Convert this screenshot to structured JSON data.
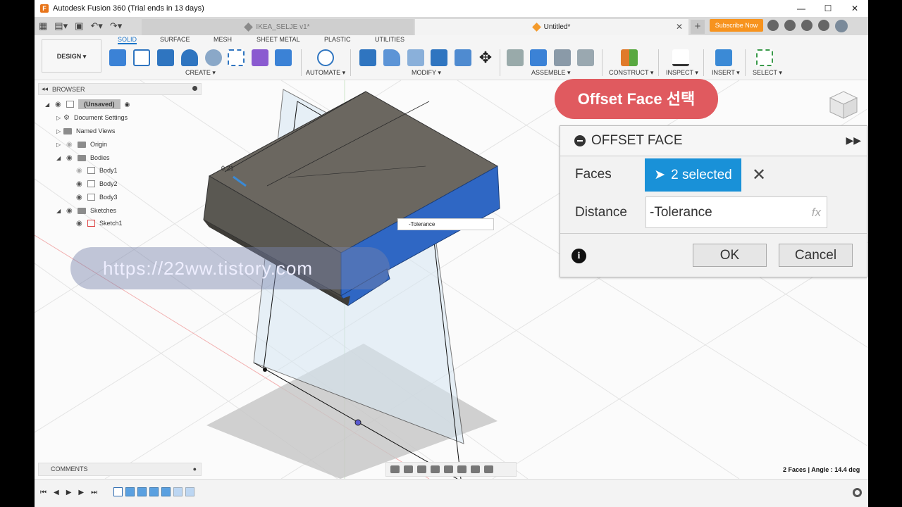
{
  "window": {
    "title": "Autodesk Fusion 360 (Trial ends in 13 days)",
    "controls": {
      "minimize": "—",
      "maximize": "☐",
      "close": "✕"
    }
  },
  "tabs": {
    "inactive_label": "IKEA_SELJE v1*",
    "active_label": "Untitled*",
    "close_glyph": "✕",
    "new_tab_glyph": "+",
    "subscribe_label": "Subscribe Now"
  },
  "ribbon": {
    "workspace_label": "DESIGN ▾",
    "tabs": [
      "SOLID",
      "SURFACE",
      "MESH",
      "SHEET METAL",
      "PLASTIC",
      "UTILITIES"
    ],
    "groups": [
      "CREATE ▾",
      "AUTOMATE ▾",
      "MODIFY ▾",
      "ASSEMBLE ▾",
      "CONSTRUCT ▾",
      "INSPECT ▾",
      "INSERT ▾",
      "SELECT ▾"
    ]
  },
  "browser": {
    "title": "BROWSER",
    "items": [
      {
        "label": "(Unsaved)"
      },
      {
        "label": "Document Settings"
      },
      {
        "label": "Named Views"
      },
      {
        "label": "Origin"
      },
      {
        "label": "Bodies"
      },
      {
        "label": "Body1"
      },
      {
        "label": "Body2"
      },
      {
        "label": "Body3"
      },
      {
        "label": "Sketches"
      },
      {
        "label": "Sketch1"
      }
    ]
  },
  "viewport": {
    "watermark": "https://22ww.tistory.com",
    "dimension_label": "0.21",
    "tolerance_tag": "-Tolerance"
  },
  "caption": {
    "text": "Offset Face 선택",
    "color": "#e05a5f"
  },
  "dialog": {
    "title": "OFFSET FACE",
    "faces_label": "Faces",
    "faces_value": "2 selected",
    "distance_label": "Distance",
    "distance_value": "-Tolerance",
    "fx_label": "fx",
    "ok_label": "OK",
    "cancel_label": "Cancel",
    "accent": "#1991d8"
  },
  "comments": {
    "title": "COMMENTS"
  },
  "status": {
    "text": "2 Faces | Angle : 14.4 deg"
  },
  "colors": {
    "subscribe": "#f7931e",
    "face_highlight": "#2f67c4",
    "body_gray": "#6e6a60"
  }
}
